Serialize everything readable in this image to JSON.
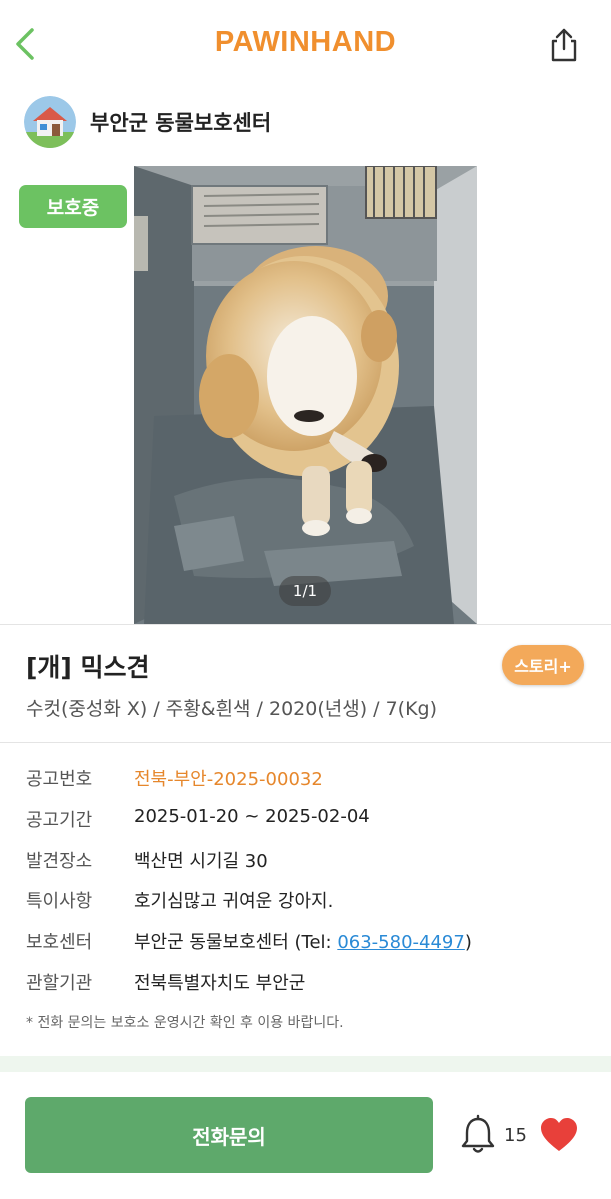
{
  "header": {
    "logo": "PAWINHAND",
    "back_icon": "chevron-left-icon",
    "share_icon": "share-icon"
  },
  "shelter": {
    "name": "부안군 동물보호센터",
    "avatar_icon": "house-icon"
  },
  "photo": {
    "status_badge": "보호중",
    "counter": "1/1"
  },
  "animal": {
    "title": "[개] 믹스견",
    "story_button": "스토리+",
    "subtitle": "수컷(중성화 X) / 주황&흰색 / 2020(년생) / 7(Kg)"
  },
  "info": {
    "notice_no_label": "공고번호",
    "notice_no_value": "전북-부안-2025-00032",
    "period_label": "공고기간",
    "period_value": "2025-01-20 ~ 2025-02-04",
    "found_label": "발견장소",
    "found_value": "백산면 시기길 30",
    "special_label": "특이사항",
    "special_value": "호기심많고 귀여운 강아지.",
    "center_label": "보호센터",
    "center_value": "부안군 동물보호센터 (Tel: ",
    "center_phone": "063-580-4497",
    "center_close": ")",
    "agency_label": "관할기관",
    "agency_value": "전북특별자치도 부안군",
    "note": "* 전화 문의는 보호소 운영시간 확인 후 이용 바랍니다."
  },
  "bottom": {
    "call_button": "전화문의",
    "bell_count": "15",
    "bell_icon": "bell-icon",
    "heart_icon": "heart-icon"
  },
  "colors": {
    "brand_orange": "#F08F2E",
    "green": "#5EA96B",
    "badge_green": "#6CC262",
    "heart_red": "#E8403A",
    "link_blue": "#2A8AD6"
  }
}
